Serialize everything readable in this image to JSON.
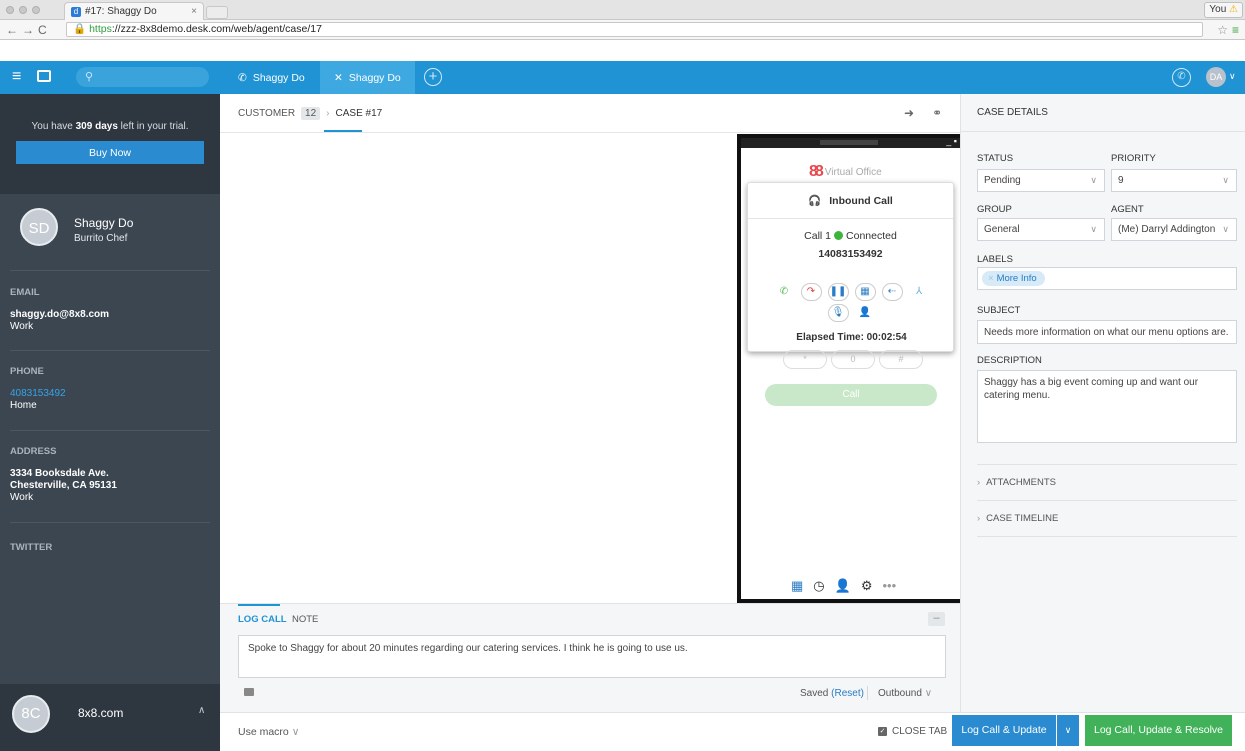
{
  "browser": {
    "tab_title": "#17: Shaggy Do",
    "tab_favicon": "d",
    "profile_label": "You",
    "url_https": "https",
    "url_rest": "://zzz-8x8demo.desk.com/web/agent/case/17"
  },
  "topbar": {
    "tab_call_label": "Shaggy Do",
    "tab_active_label": "Shaggy Do",
    "avatar_initials": "DA"
  },
  "sidebar": {
    "trial_pre": "You have ",
    "trial_days": "309 days",
    "trial_post": " left in your trial.",
    "buy_now": "Buy Now",
    "avatar_initials": "SD",
    "name": "Shaggy Do",
    "title": "Burrito Chef",
    "email_label": "EMAIL",
    "email_value": "shaggy.do@8x8.com",
    "email_type": "Work",
    "phone_label": "PHONE",
    "phone_value": "4083153492",
    "phone_type": "Home",
    "address_label": "ADDRESS",
    "address_line1": "3334 Booksdale Ave.",
    "address_line2": "Chesterville, CA 95131",
    "address_type": "Work",
    "twitter_label": "TWITTER",
    "footer_initials": "8C",
    "footer_name": "8x8.com"
  },
  "breadcrumb": {
    "customer": "CUSTOMER",
    "count": "12",
    "case": "CASE #17"
  },
  "softphone": {
    "brand": "Virtual Office",
    "popup_title": "Inbound Call",
    "call_label": "Call 1",
    "call_status": "Connected",
    "call_number": "14083153492",
    "elapsed": "Elapsed Time: 00:02:54",
    "keys": [
      "*",
      "0",
      "#"
    ],
    "call_button": "Call"
  },
  "case_details": {
    "title": "CASE DETAILS",
    "status_label": "STATUS",
    "status_value": "Pending",
    "priority_label": "PRIORITY",
    "priority_value": "9",
    "group_label": "GROUP",
    "group_value": "General",
    "agent_label": "AGENT",
    "agent_value": "(Me) Darryl Addington",
    "labels_label": "LABELS",
    "label_tag": "More Info",
    "subject_label": "SUBJECT",
    "subject_value": "Needs more information on what our menu options are.",
    "description_label": "DESCRIPTION",
    "description_value": "Shaggy has a big event coming up and want our catering menu.",
    "attachments": "ATTACHMENTS",
    "timeline": "CASE TIMELINE"
  },
  "composer": {
    "tab_log": "LOG CALL",
    "tab_note": "NOTE",
    "text": "Spoke to Shaggy for about 20 minutes regarding our catering services. I think he is going to use us.",
    "saved": "Saved",
    "reset": "(Reset)",
    "direction": "Outbound"
  },
  "bottombar": {
    "macro": "Use macro",
    "close_tab": "CLOSE TAB",
    "log_update": "Log Call & Update",
    "log_resolve": "Log Call, Update & Resolve"
  },
  "colors": {
    "topbar": "#1f93d3",
    "sidebar": "#3c4651",
    "primary_button": "#2a8bd0",
    "resolve_button": "#42b25a"
  }
}
